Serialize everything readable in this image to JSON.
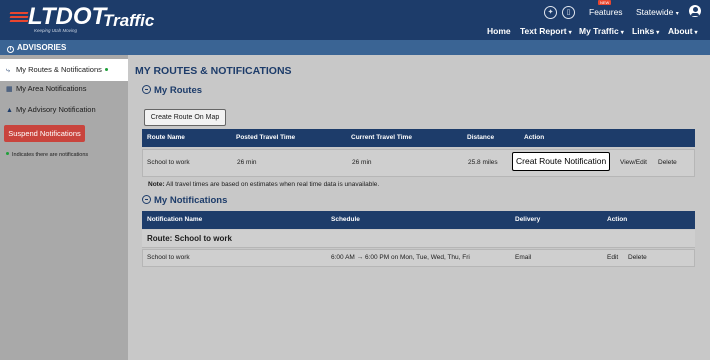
{
  "header": {
    "logo_text": "LTDOT",
    "tagline": "Keeping Utah Moving",
    "product": "Traffic",
    "features_label": "Features",
    "new_badge": "NEW",
    "region_label": "Statewide",
    "nav": {
      "home": "Home",
      "text_report": "Text Report",
      "my_traffic": "My Traffic",
      "links": "Links",
      "about": "About"
    }
  },
  "advisories": {
    "label": "ADVISORIES"
  },
  "sidebar": {
    "items": [
      {
        "label": "My Routes & Notifications",
        "icon": "route-icon",
        "active": true,
        "has_notifications": true
      },
      {
        "label": "My Area Notifications",
        "icon": "map-icon",
        "active": false
      },
      {
        "label": "My Advisory Notification",
        "icon": "warning-icon",
        "active": false
      }
    ],
    "suspend_label": "Suspend Notifications",
    "legend_text": "Indicates there are notifications"
  },
  "main": {
    "title": "MY ROUTES & NOTIFICATIONS",
    "routes_section": {
      "title": "My Routes",
      "create_button": "Create Route On Map",
      "columns": [
        "Route Name",
        "Posted Travel Time",
        "Current Travel Time",
        "Distance",
        "Action"
      ],
      "rows": [
        {
          "name": "School to work",
          "posted": "26 min",
          "current": "26 min",
          "distance": "25.8 miles",
          "actions": [
            "View/Edit",
            "Delete"
          ]
        }
      ],
      "callout": "Creat Route Notification",
      "note_label": "Note:",
      "note_text": " All travel times are based on estimates when real time data is unavailable."
    },
    "notifications_section": {
      "title": "My Notifications",
      "columns": [
        "Notification Name",
        "Schedule",
        "Delivery",
        "Action"
      ],
      "group": "Route: School to work",
      "rows": [
        {
          "name": "School to work",
          "schedule": "6:00 AM → 6:00 PM on Mon, Tue, Wed, Thu, Fri",
          "delivery": "Email",
          "actions": [
            "Edit",
            "Delete"
          ]
        }
      ]
    }
  },
  "colors": {
    "header_bg": "#1d3c6a",
    "advisory_bar": "#3a6494",
    "accent_red": "#c9443d",
    "notification_dot": "#1fa03a"
  }
}
